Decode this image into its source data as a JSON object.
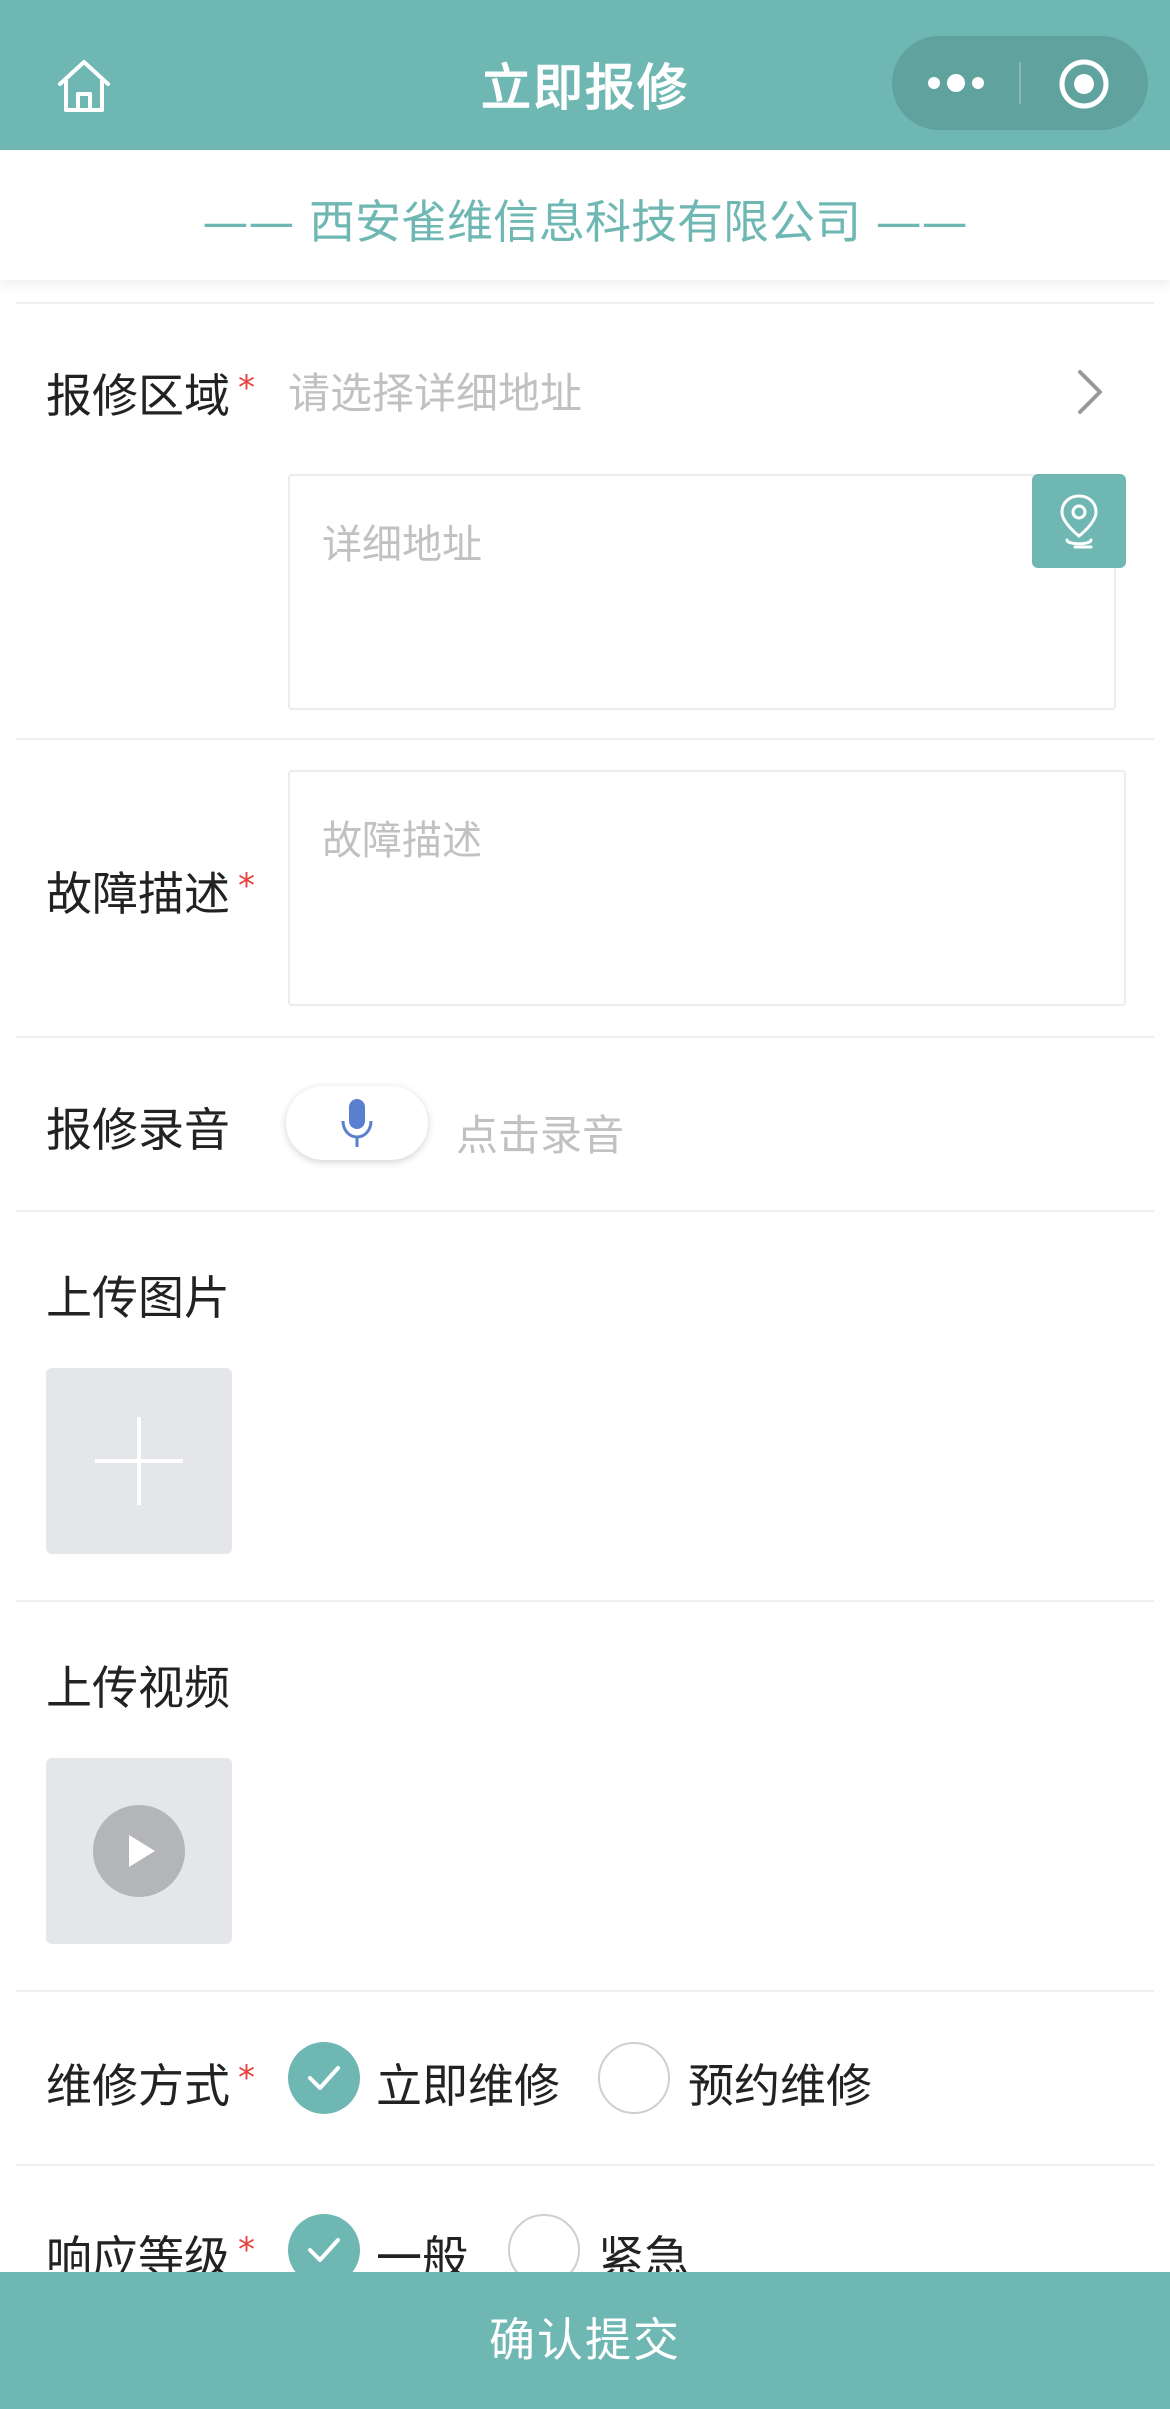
{
  "header": {
    "title": "立即报修",
    "home_icon": "home-icon",
    "more_icon": "more-dots-icon",
    "target_icon": "target-icon",
    "bg_color": "#6fb7b3"
  },
  "company": {
    "name": "—— 西安雀维信息科技有限公司 ——"
  },
  "form": {
    "area": {
      "label": "报修区域",
      "required_mark": "*",
      "picker_placeholder": "请选择详细地址",
      "detail_placeholder": "详细地址",
      "location_icon": "location-icon"
    },
    "fault": {
      "label": "故障描述",
      "required_mark": "*",
      "placeholder": "故障描述"
    },
    "recording": {
      "label": "报修录音",
      "hint": "点击录音",
      "mic_icon": "microphone-icon"
    },
    "image": {
      "label": "上传图片",
      "add_icon": "plus-icon"
    },
    "video": {
      "label": "上传视频",
      "play_icon": "play-icon"
    },
    "repair_method": {
      "label": "维修方式",
      "required_mark": "*",
      "options": [
        {
          "label": "立即维修",
          "selected": true
        },
        {
          "label": "预约维修",
          "selected": false
        }
      ]
    },
    "response_level": {
      "label": "响应等级",
      "required_mark": "*",
      "options": [
        {
          "label": "一般",
          "selected": true
        },
        {
          "label": "紧急",
          "selected": false
        }
      ]
    }
  },
  "submit": {
    "label": "确认提交"
  }
}
